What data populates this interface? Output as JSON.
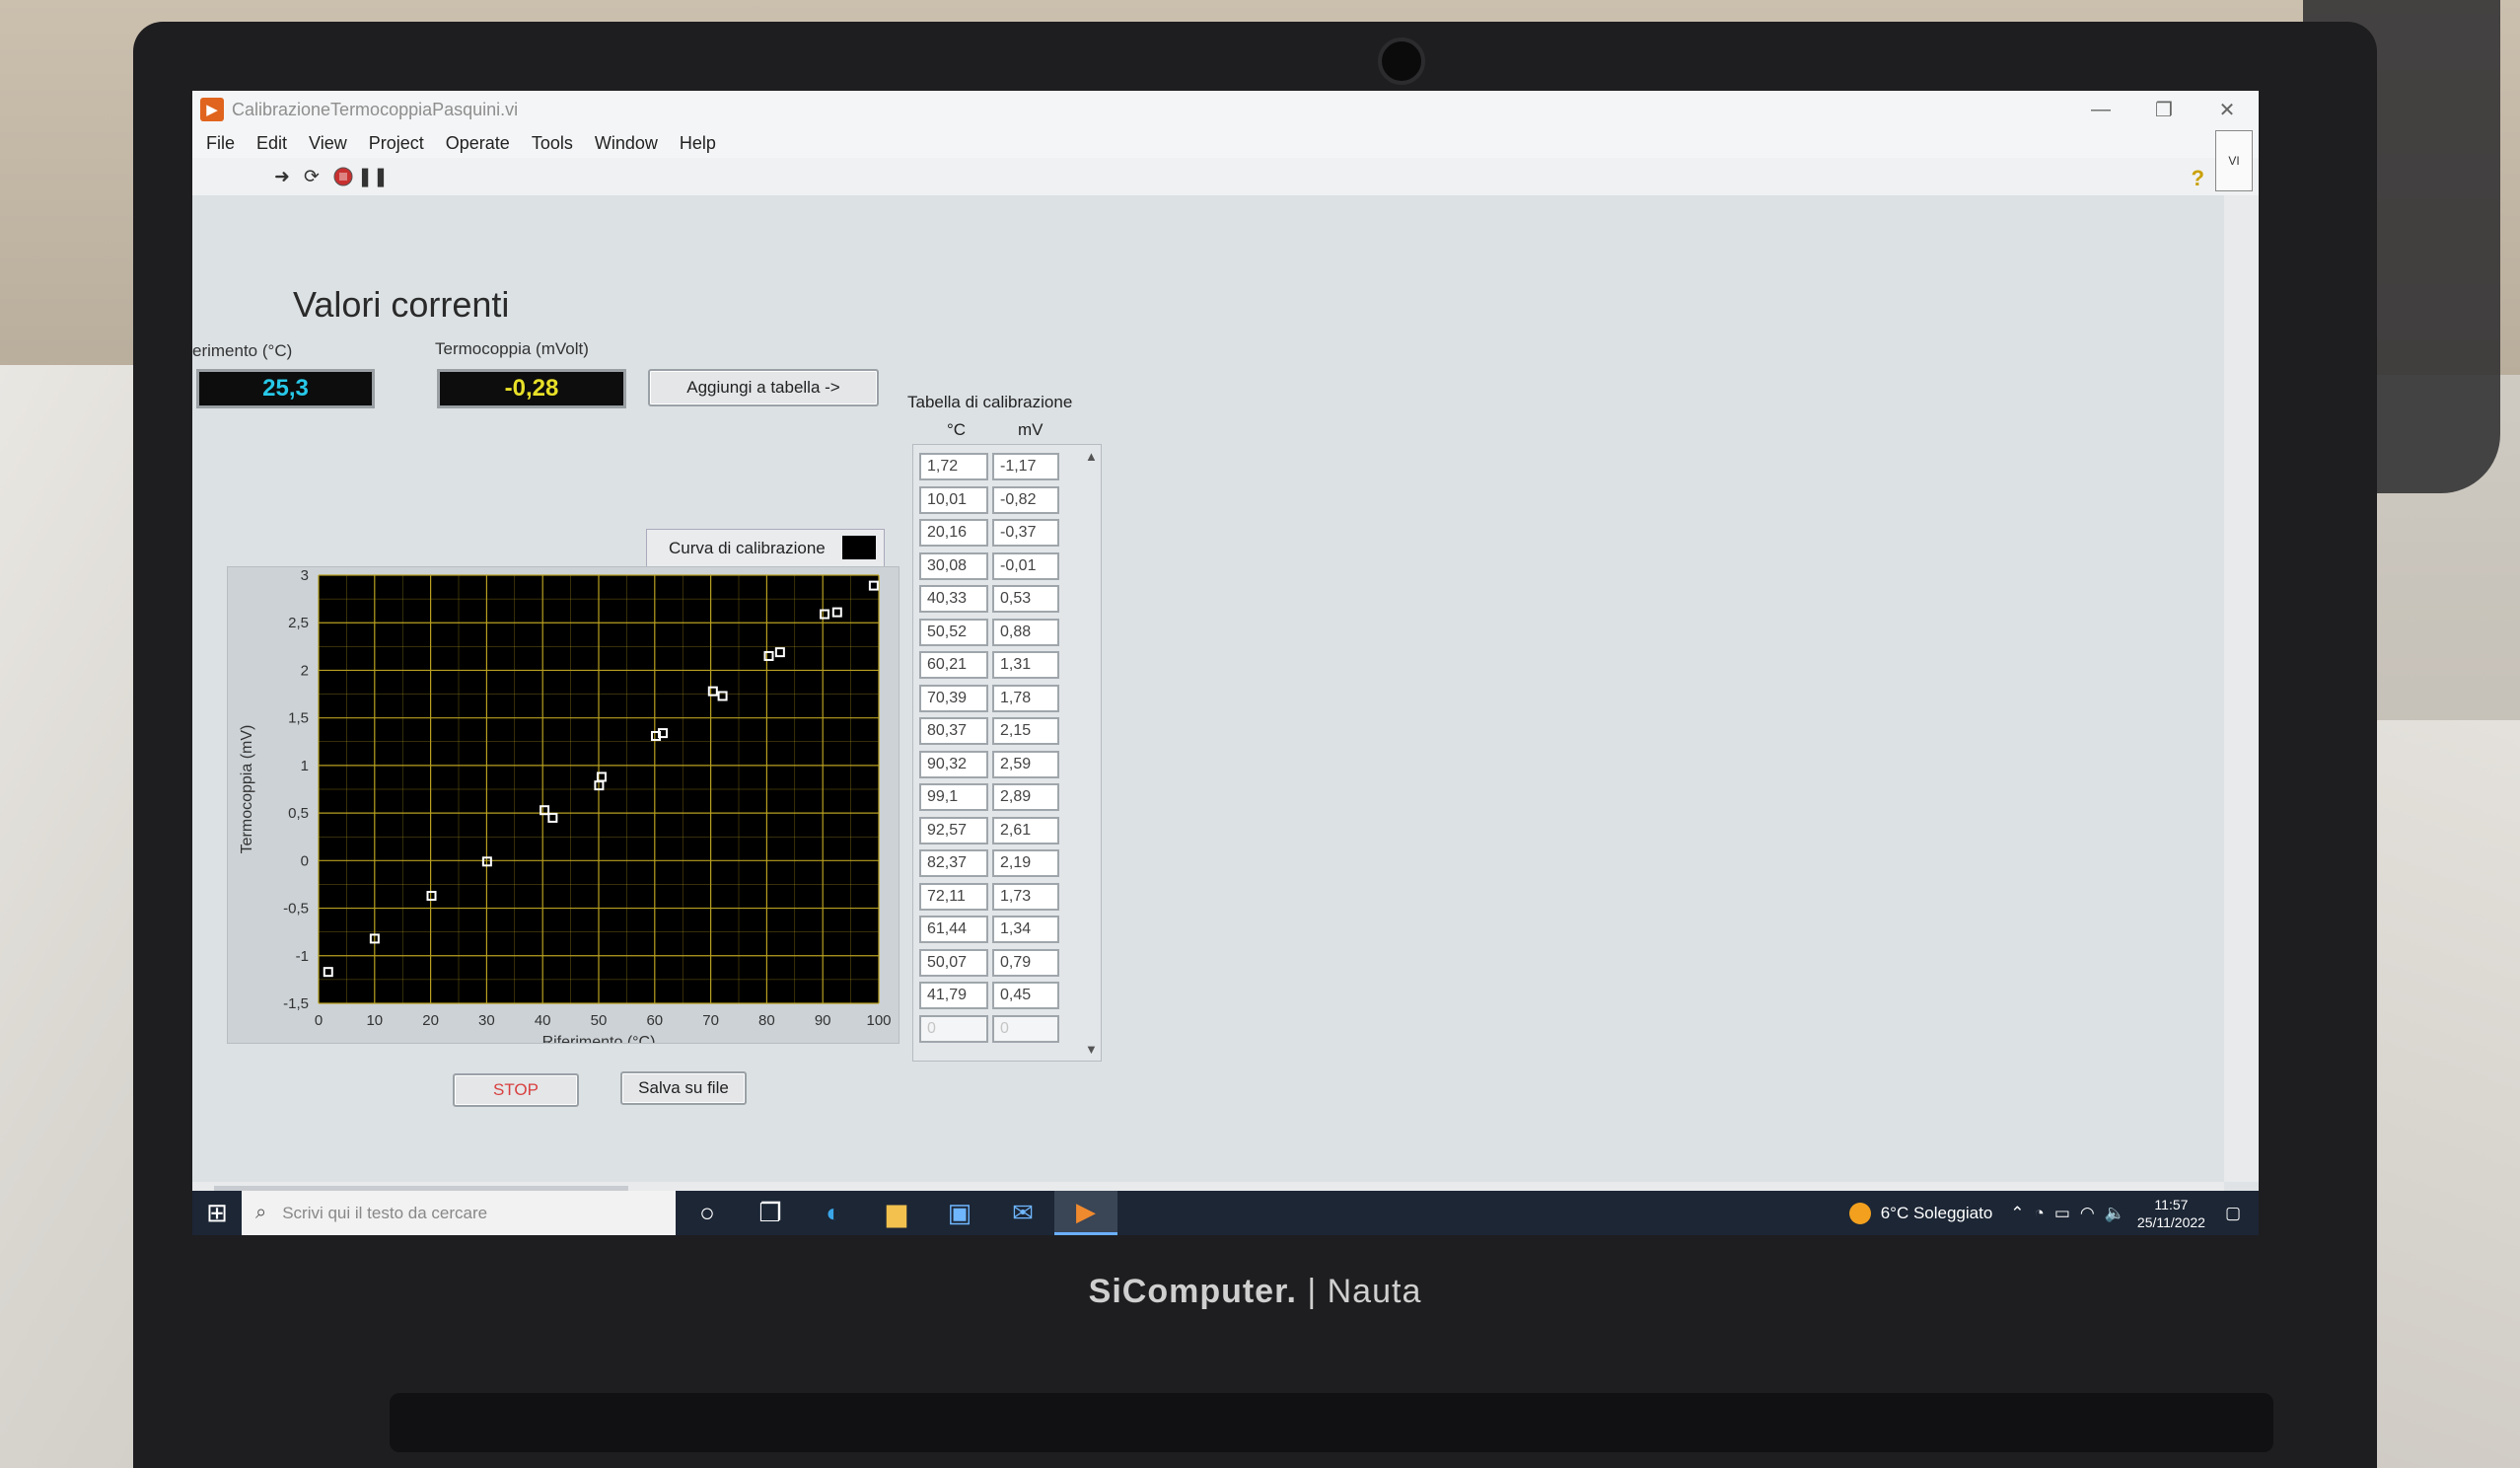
{
  "window": {
    "title": "CalibrazioneTermocoppiaPasquini.vi",
    "controls": [
      "—",
      "❐",
      "✕"
    ]
  },
  "menu": [
    "File",
    "Edit",
    "View",
    "Project",
    "Operate",
    "Tools",
    "Window",
    "Help"
  ],
  "toolbar": {
    "icons": [
      "run-arrow-icon",
      "run-continuously-icon",
      "abort-icon",
      "pause-icon"
    ],
    "help": "?"
  },
  "panel": {
    "heading": "Valori correnti",
    "ref_label": "erimento (°C)",
    "ref_value": "25,3",
    "tc_label": "Termocoppia (mVolt)",
    "tc_value": "-0,28",
    "add_button": "Aggiungi a tabella ->",
    "legend_label": "Curva di calibrazione",
    "stop_button": "STOP",
    "save_button": "Salva su file",
    "ref_color": "#27c8e8",
    "tc_color": "#e8e028"
  },
  "table": {
    "title": "Tabella di calibrazione",
    "col_c": "°C",
    "col_mv": "mV",
    "rows": [
      [
        "1,72",
        "-1,17"
      ],
      [
        "10,01",
        "-0,82"
      ],
      [
        "20,16",
        "-0,37"
      ],
      [
        "30,08",
        "-0,01"
      ],
      [
        "40,33",
        "0,53"
      ],
      [
        "50,52",
        "0,88"
      ],
      [
        "60,21",
        "1,31"
      ],
      [
        "70,39",
        "1,78"
      ],
      [
        "80,37",
        "2,15"
      ],
      [
        "90,32",
        "2,59"
      ],
      [
        "99,1",
        "2,89"
      ],
      [
        "92,57",
        "2,61"
      ],
      [
        "82,37",
        "2,19"
      ],
      [
        "72,11",
        "1,73"
      ],
      [
        "61,44",
        "1,34"
      ],
      [
        "50,07",
        "0,79"
      ],
      [
        "41,79",
        "0,45"
      ],
      [
        "0",
        "0"
      ]
    ]
  },
  "chart_data": {
    "type": "scatter",
    "xlabel": "Riferimento (°C)",
    "ylabel": "Termocoppia (mV)",
    "xlim": [
      0,
      100
    ],
    "ylim": [
      -1.5,
      3
    ],
    "x_ticks": [
      "0",
      "10",
      "20",
      "30",
      "40",
      "50",
      "60",
      "70",
      "80",
      "90",
      "100"
    ],
    "y_ticks": [
      "-1,5",
      "-1",
      "-0,5",
      "0",
      "0,5",
      "1",
      "1,5",
      "2",
      "2,5",
      "3"
    ],
    "grid": true,
    "background": "#000000",
    "grid_color": "#b8a020",
    "marker_color": "#ffffff",
    "points": [
      [
        1.72,
        -1.17
      ],
      [
        10.01,
        -0.82
      ],
      [
        20.16,
        -0.37
      ],
      [
        30.08,
        -0.01
      ],
      [
        40.33,
        0.53
      ],
      [
        50.52,
        0.88
      ],
      [
        60.21,
        1.31
      ],
      [
        70.39,
        1.78
      ],
      [
        80.37,
        2.15
      ],
      [
        90.32,
        2.59
      ],
      [
        99.1,
        2.89
      ],
      [
        92.57,
        2.61
      ],
      [
        82.37,
        2.19
      ],
      [
        72.11,
        1.73
      ],
      [
        61.44,
        1.34
      ],
      [
        50.07,
        0.79
      ],
      [
        41.79,
        0.45
      ]
    ]
  },
  "taskbar": {
    "search_placeholder": "Scrivi qui il testo da cercare",
    "weather": "6°C Soleggiato",
    "time": "11:57",
    "date": "25/11/2022",
    "apps": [
      "cortana-icon",
      "task-view-icon",
      "edge-icon",
      "explorer-icon",
      "store-icon",
      "mail-icon",
      "labview-icon"
    ]
  },
  "laptop": {
    "brand": "SiComputer.",
    "model": "Nauta"
  }
}
